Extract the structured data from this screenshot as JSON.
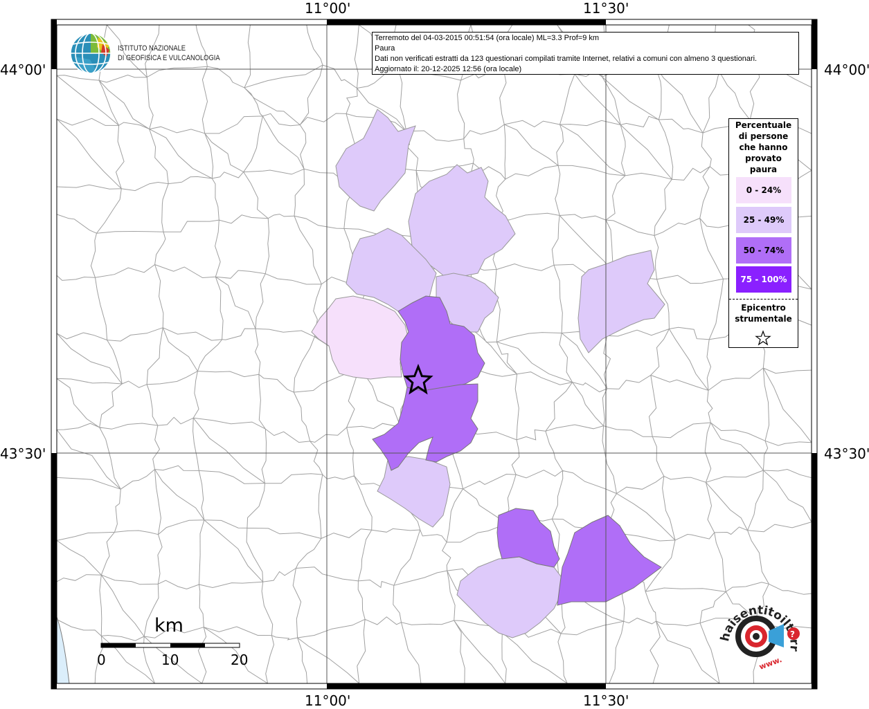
{
  "map": {
    "coordinates": {
      "lon_top_left": "11°00'",
      "lon_top_right": "11°30'",
      "lon_bottom_left": "11°00'",
      "lon_bottom_right": "11°30'",
      "lat_top_left": "44°00'",
      "lat_top_right": "44°00'",
      "lat_bottom_left": "43°30'",
      "lat_bottom_right": "43°30'"
    },
    "colors": {
      "class_0_24": "#f6e0fb",
      "class_25_49": "#decafa",
      "class_50_74": "#b06ef7",
      "class_75_100": "#8a20ff",
      "sea": "#dbeefb",
      "borders": "#9a9a9a"
    }
  },
  "info": {
    "line1": "Terremoto del 04-03-2015 00:51:54 (ora locale) ML=3.3 Prof=9 km",
    "line2": "Paura",
    "line3": "Dati non verificati estratti da 123 questionari compilati tramite Internet, relativi a comuni con almeno 3 questionari.",
    "line4": "Aggiornato il: 20-12-2025 12:56 (ora locale)"
  },
  "logo": {
    "line1": "ISTITUTO NAZIONALE",
    "line2": "DI GEOFISICA E VULCANOLOGIA"
  },
  "legend": {
    "title": [
      "Percentuale",
      "di persone",
      "che hanno",
      "provato",
      "paura"
    ],
    "classes": [
      {
        "label": "0 - 24%",
        "color": "#f6e0fb"
      },
      {
        "label": "25 - 49%",
        "color": "#decafa"
      },
      {
        "label": "50 - 74%",
        "color": "#b06ef7"
      },
      {
        "label": "75 - 100%",
        "color": "#8a20ff"
      }
    ],
    "epicenter": [
      "Epicentro",
      "strumentale"
    ],
    "epicenter_icon": "star-icon"
  },
  "scalebar": {
    "unit": "km",
    "ticks": [
      "0",
      "10",
      "20"
    ]
  },
  "hsi_logo": {
    "text": "haisentitoilterremoto.it",
    "prefix": "www."
  }
}
